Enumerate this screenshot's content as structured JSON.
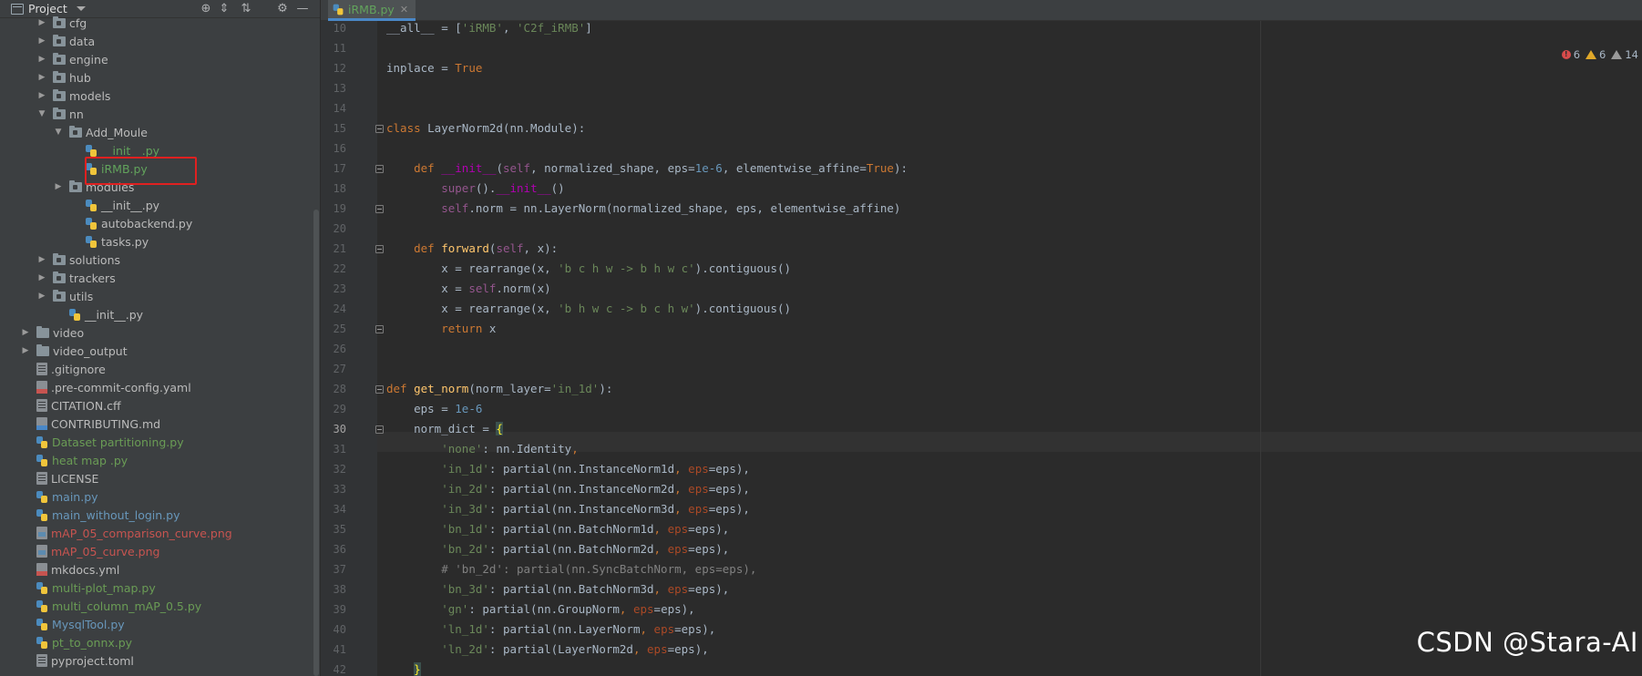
{
  "project": {
    "title": "Project",
    "tree": [
      {
        "label": "cfg",
        "kind": "folder",
        "color": "default",
        "expanded": false
      },
      {
        "label": "data",
        "kind": "folder",
        "color": "default",
        "expanded": false
      },
      {
        "label": "engine",
        "kind": "folder",
        "color": "default",
        "expanded": false
      },
      {
        "label": "hub",
        "kind": "folder",
        "color": "default",
        "expanded": false
      },
      {
        "label": "models",
        "kind": "folder",
        "color": "default",
        "expanded": false
      },
      {
        "label": "nn",
        "kind": "folder",
        "color": "default",
        "expanded": true
      },
      {
        "label": "Add_Moule",
        "kind": "folder",
        "color": "default",
        "expanded": true
      },
      {
        "label": "__init__.py",
        "kind": "py",
        "color": "green"
      },
      {
        "label": "iRMB.py",
        "kind": "py",
        "color": "green"
      },
      {
        "label": "modules",
        "kind": "folder",
        "color": "default",
        "expanded": false
      },
      {
        "label": "__init__.py",
        "kind": "py",
        "color": "default"
      },
      {
        "label": "autobackend.py",
        "kind": "py",
        "color": "default"
      },
      {
        "label": "tasks.py",
        "kind": "py",
        "color": "default"
      },
      {
        "label": "solutions",
        "kind": "folder",
        "color": "default",
        "expanded": false
      },
      {
        "label": "trackers",
        "kind": "folder",
        "color": "default",
        "expanded": false
      },
      {
        "label": "utils",
        "kind": "folder",
        "color": "default",
        "expanded": false
      },
      {
        "label": "__init__.py",
        "kind": "py",
        "color": "default"
      },
      {
        "label": "video",
        "kind": "folder",
        "color": "default",
        "expanded": false
      },
      {
        "label": "video_output",
        "kind": "folder",
        "color": "default",
        "expanded": false
      },
      {
        "label": ".gitignore",
        "kind": "gen",
        "color": "default"
      },
      {
        "label": ".pre-commit-config.yaml",
        "kind": "yml",
        "color": "default"
      },
      {
        "label": "CITATION.cff",
        "kind": "gen",
        "color": "default"
      },
      {
        "label": "CONTRIBUTING.md",
        "kind": "md",
        "color": "default"
      },
      {
        "label": "Dataset partitioning.py",
        "kind": "py",
        "color": "lgreen"
      },
      {
        "label": "heat map .py",
        "kind": "py",
        "color": "lgreen"
      },
      {
        "label": "LICENSE",
        "kind": "gen",
        "color": "default"
      },
      {
        "label": "main.py",
        "kind": "py",
        "color": "blue"
      },
      {
        "label": "main_without_login.py",
        "kind": "py",
        "color": "blue"
      },
      {
        "label": "mAP_05_comparison_curve.png",
        "kind": "img",
        "color": "red"
      },
      {
        "label": "mAP_05_curve.png",
        "kind": "img",
        "color": "red"
      },
      {
        "label": "mkdocs.yml",
        "kind": "yml",
        "color": "default"
      },
      {
        "label": "multi-plot_map.py",
        "kind": "py",
        "color": "lgreen"
      },
      {
        "label": "multi_column_mAP_0.5.py",
        "kind": "py",
        "color": "lgreen"
      },
      {
        "label": "MysqlTool.py",
        "kind": "py",
        "color": "blue"
      },
      {
        "label": "pt_to_onnx.py",
        "kind": "py",
        "color": "lgreen"
      },
      {
        "label": "pyproject.toml",
        "kind": "gen",
        "color": "default"
      }
    ]
  },
  "editor": {
    "tab_label": "iRMB.py",
    "inspections": {
      "errors": "6",
      "warnings": "6",
      "weak": "14"
    },
    "lines": [
      {
        "n": "10",
        "tokens": [
          [
            "",
            "__all__ = ["
          ],
          [
            "str",
            "'iRMB'"
          ],
          [
            "",
            ", "
          ],
          [
            "str",
            "'C2f_iRMB'"
          ],
          [
            "",
            "]"
          ]
        ]
      },
      {
        "n": "11",
        "tokens": []
      },
      {
        "n": "12",
        "tokens": [
          [
            "",
            "inplace = "
          ],
          [
            "kw",
            "True"
          ]
        ]
      },
      {
        "n": "13",
        "tokens": []
      },
      {
        "n": "14",
        "tokens": []
      },
      {
        "n": "15",
        "tokens": [
          [
            "kw",
            "class "
          ],
          [
            "",
            "LayerNorm2d(nn.Module):"
          ]
        ]
      },
      {
        "n": "16",
        "tokens": []
      },
      {
        "n": "17",
        "tokens": [
          [
            "",
            "    "
          ],
          [
            "kw",
            "def "
          ],
          [
            "dunder",
            "__init__"
          ],
          [
            "",
            "("
          ],
          [
            "self",
            "self"
          ],
          [
            "",
            ", normalized_shape, eps="
          ],
          [
            "num",
            "1e-6"
          ],
          [
            "",
            ", elementwise_affine="
          ],
          [
            "kw",
            "True"
          ],
          [
            "",
            "):"
          ]
        ]
      },
      {
        "n": "18",
        "tokens": [
          [
            "",
            "        "
          ],
          [
            "self",
            "super"
          ],
          [
            "",
            "()."
          ],
          [
            "dunder",
            "__init__"
          ],
          [
            "",
            "()"
          ]
        ]
      },
      {
        "n": "19",
        "tokens": [
          [
            "",
            "        "
          ],
          [
            "self",
            "self"
          ],
          [
            "",
            ".norm = nn.LayerNorm(normalized_shape, eps, elementwise_affine)"
          ]
        ]
      },
      {
        "n": "20",
        "tokens": []
      },
      {
        "n": "21",
        "tokens": [
          [
            "",
            "    "
          ],
          [
            "kw",
            "def "
          ],
          [
            "fn",
            "forward"
          ],
          [
            "",
            "("
          ],
          [
            "self",
            "self"
          ],
          [
            "",
            ", x):"
          ]
        ]
      },
      {
        "n": "22",
        "tokens": [
          [
            "",
            "        x = rearrange(x, "
          ],
          [
            "str",
            "'b c h w -> b h w c'"
          ],
          [
            "",
            ").contiguous()"
          ]
        ]
      },
      {
        "n": "23",
        "tokens": [
          [
            "",
            "        x = "
          ],
          [
            "self",
            "self"
          ],
          [
            "",
            ".norm(x)"
          ]
        ]
      },
      {
        "n": "24",
        "tokens": [
          [
            "",
            "        x = rearrange(x, "
          ],
          [
            "str",
            "'b h w c -> b c h w'"
          ],
          [
            "",
            ").contiguous()"
          ]
        ]
      },
      {
        "n": "25",
        "tokens": [
          [
            "",
            "        "
          ],
          [
            "kw",
            "return "
          ],
          [
            "",
            "x"
          ]
        ]
      },
      {
        "n": "26",
        "tokens": []
      },
      {
        "n": "27",
        "tokens": []
      },
      {
        "n": "28",
        "tokens": [
          [
            "kw",
            "def "
          ],
          [
            "fn",
            "get_norm"
          ],
          [
            "",
            "(norm_layer="
          ],
          [
            "str",
            "'in_1d'"
          ],
          [
            "",
            "):"
          ]
        ]
      },
      {
        "n": "29",
        "tokens": [
          [
            "",
            "    eps = "
          ],
          [
            "num",
            "1e-6"
          ]
        ]
      },
      {
        "n": "30",
        "tokens": [
          [
            "",
            "    norm_dict = "
          ],
          [
            "brace",
            "{"
          ]
        ]
      },
      {
        "n": "31",
        "tokens": [
          [
            "",
            "        "
          ],
          [
            "str",
            "'none'"
          ],
          [
            "",
            ": nn.Identity"
          ],
          [
            "kw",
            ","
          ]
        ]
      },
      {
        "n": "32",
        "tokens": [
          [
            "",
            "        "
          ],
          [
            "str",
            "'in_1d'"
          ],
          [
            "",
            ": partial(nn.InstanceNorm1d"
          ],
          [
            "kw",
            ", "
          ],
          [
            "param",
            "eps"
          ],
          [
            "",
            "=eps),"
          ]
        ]
      },
      {
        "n": "33",
        "tokens": [
          [
            "",
            "        "
          ],
          [
            "str",
            "'in_2d'"
          ],
          [
            "",
            ": partial(nn.InstanceNorm2d"
          ],
          [
            "kw",
            ", "
          ],
          [
            "param",
            "eps"
          ],
          [
            "",
            "=eps),"
          ]
        ]
      },
      {
        "n": "34",
        "tokens": [
          [
            "",
            "        "
          ],
          [
            "str",
            "'in_3d'"
          ],
          [
            "",
            ": partial(nn.InstanceNorm3d"
          ],
          [
            "kw",
            ", "
          ],
          [
            "param",
            "eps"
          ],
          [
            "",
            "=eps),"
          ]
        ]
      },
      {
        "n": "35",
        "tokens": [
          [
            "",
            "        "
          ],
          [
            "str",
            "'bn_1d'"
          ],
          [
            "",
            ": partial(nn.BatchNorm1d"
          ],
          [
            "kw",
            ", "
          ],
          [
            "param",
            "eps"
          ],
          [
            "",
            "=eps),"
          ]
        ]
      },
      {
        "n": "36",
        "tokens": [
          [
            "",
            "        "
          ],
          [
            "str",
            "'bn_2d'"
          ],
          [
            "",
            ": partial(nn.BatchNorm2d"
          ],
          [
            "kw",
            ", "
          ],
          [
            "param",
            "eps"
          ],
          [
            "",
            "=eps),"
          ]
        ]
      },
      {
        "n": "37",
        "tokens": [
          [
            "",
            "        "
          ],
          [
            "cmt",
            "# 'bn_2d': partial(nn.SyncBatchNorm, eps=eps),"
          ]
        ]
      },
      {
        "n": "38",
        "tokens": [
          [
            "",
            "        "
          ],
          [
            "str",
            "'bn_3d'"
          ],
          [
            "",
            ": partial(nn.BatchNorm3d"
          ],
          [
            "kw",
            ", "
          ],
          [
            "param",
            "eps"
          ],
          [
            "",
            "=eps),"
          ]
        ]
      },
      {
        "n": "39",
        "tokens": [
          [
            "",
            "        "
          ],
          [
            "str",
            "'gn'"
          ],
          [
            "",
            ": partial(nn.GroupNorm"
          ],
          [
            "kw",
            ", "
          ],
          [
            "param",
            "eps"
          ],
          [
            "",
            "=eps),"
          ]
        ]
      },
      {
        "n": "40",
        "tokens": [
          [
            "",
            "        "
          ],
          [
            "str",
            "'ln_1d'"
          ],
          [
            "",
            ": partial(nn.LayerNorm"
          ],
          [
            "kw",
            ", "
          ],
          [
            "param",
            "eps"
          ],
          [
            "",
            "=eps),"
          ]
        ]
      },
      {
        "n": "41",
        "tokens": [
          [
            "",
            "        "
          ],
          [
            "str",
            "'ln_2d'"
          ],
          [
            "",
            ": partial(LayerNorm2d"
          ],
          [
            "kw",
            ", "
          ],
          [
            "param",
            "eps"
          ],
          [
            "",
            "=eps),"
          ]
        ]
      },
      {
        "n": "42",
        "tokens": [
          [
            "",
            "    "
          ],
          [
            "brace",
            "}"
          ]
        ]
      }
    ]
  },
  "watermark": "CSDN @Stara-AI"
}
